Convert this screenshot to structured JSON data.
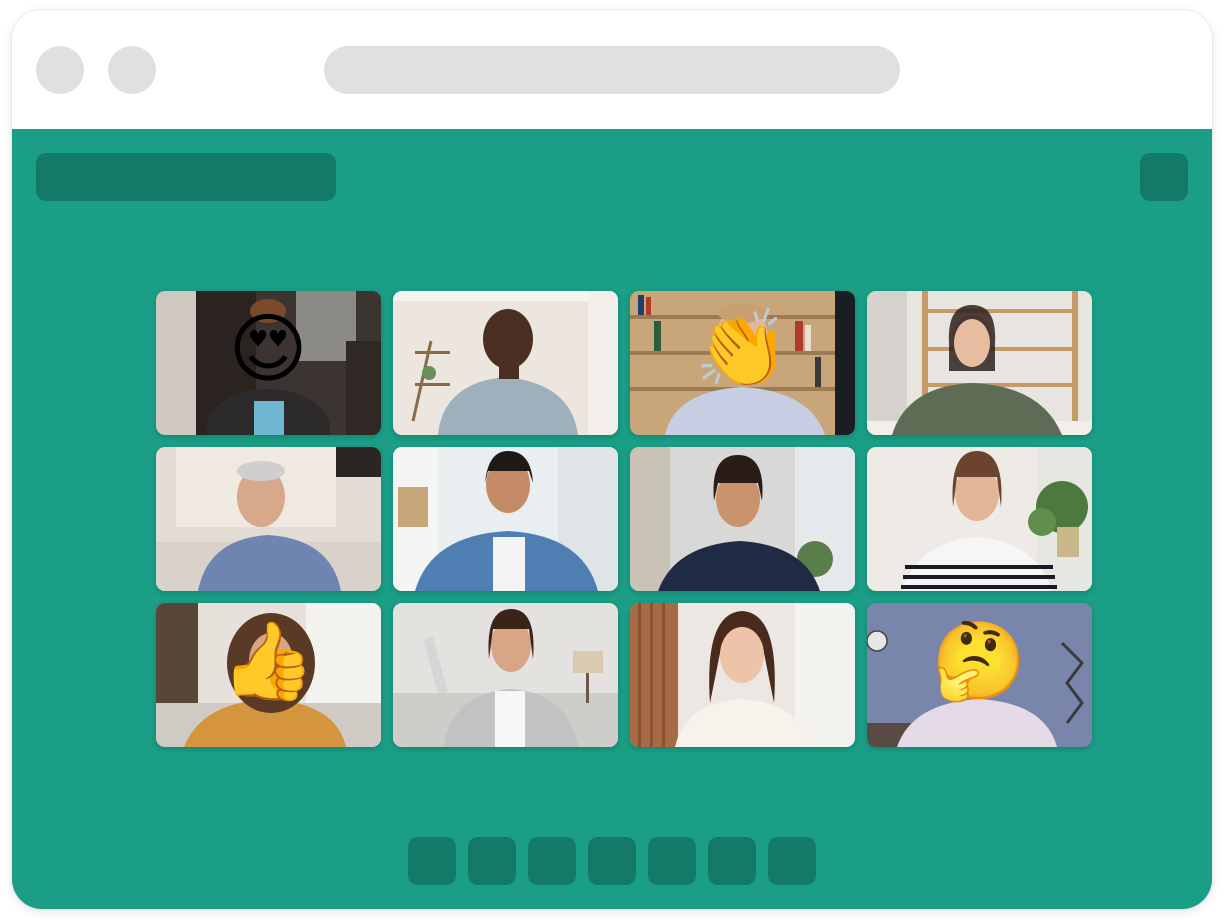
{
  "colors": {
    "app_background": "#1a9e86",
    "toolbar_element": "#137a67",
    "browser_chrome": "#ffffff",
    "placeholder_gray": "#e0e0e0"
  },
  "participants": [
    {
      "id": "participant-1",
      "reaction": "😍",
      "reaction_name": "heart-eyes-emoji"
    },
    {
      "id": "participant-2",
      "reaction": "",
      "reaction_name": ""
    },
    {
      "id": "participant-3",
      "reaction": "👏",
      "reaction_name": "clapping-hands-emoji"
    },
    {
      "id": "participant-4",
      "reaction": "",
      "reaction_name": ""
    },
    {
      "id": "participant-5",
      "reaction": "",
      "reaction_name": ""
    },
    {
      "id": "participant-6",
      "reaction": "",
      "reaction_name": ""
    },
    {
      "id": "participant-7",
      "reaction": "",
      "reaction_name": ""
    },
    {
      "id": "participant-8",
      "reaction": "",
      "reaction_name": ""
    },
    {
      "id": "participant-9",
      "reaction": "👍",
      "reaction_name": "thumbs-up-emoji"
    },
    {
      "id": "participant-10",
      "reaction": "",
      "reaction_name": ""
    },
    {
      "id": "participant-11",
      "reaction": "",
      "reaction_name": ""
    },
    {
      "id": "participant-12",
      "reaction": "🤔",
      "reaction_name": "thinking-face-emoji"
    }
  ],
  "controls": [
    {
      "id": "control-1"
    },
    {
      "id": "control-2"
    },
    {
      "id": "control-3"
    },
    {
      "id": "control-4"
    },
    {
      "id": "control-5"
    },
    {
      "id": "control-6"
    },
    {
      "id": "control-7"
    }
  ]
}
